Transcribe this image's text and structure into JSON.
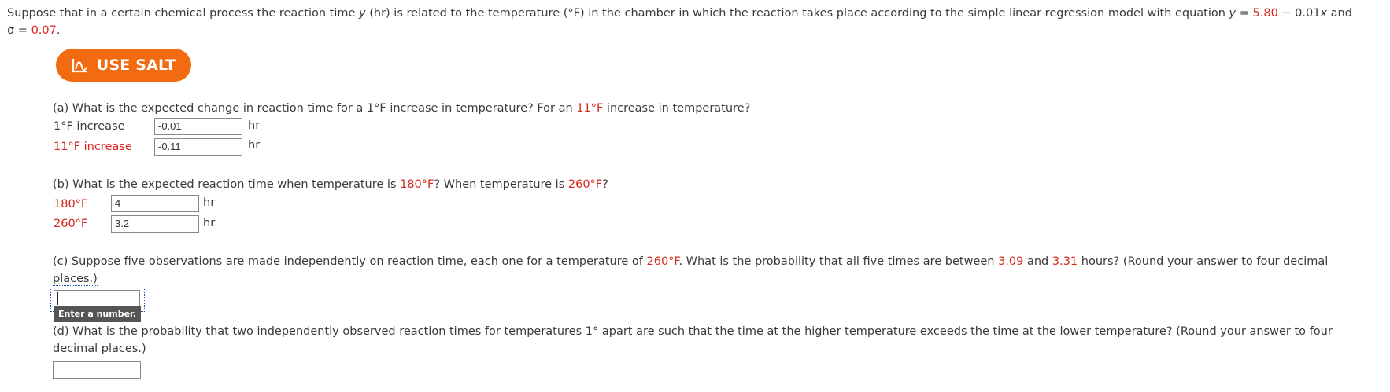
{
  "intro": {
    "line1_a": "Suppose that in a certain chemical process the reaction time ",
    "line1_var_y": "y",
    "line1_b": " (hr) is related to the temperature (°F) in the chamber in which the reaction takes place according to the simple linear regression model with equation ",
    "line1_eq_y": "y",
    "line1_eq": " = ",
    "line1_intercept": "5.80",
    "line1_eq2": " − 0.01",
    "line1_eq_x": "x",
    "line1_end": " and",
    "line2_sigma": "σ",
    "line2_eq": " = ",
    "line2_value": "0.07",
    "line2_end": "."
  },
  "salt_button": {
    "label": "USE SALT",
    "color": "#f26b10"
  },
  "part_a": {
    "q1": "(a) What is the expected change in reaction time for a 1°F increase in temperature? For an ",
    "q_red": "11°F",
    "q2": " increase in temperature?",
    "row1_label": "1°F increase",
    "row1_value": "-0.01",
    "row1_unit": "hr",
    "row2_label": "11°F increase",
    "row2_value": "-0.11",
    "row2_unit": "hr"
  },
  "part_b": {
    "q1": "(b) What is the expected reaction time when temperature is ",
    "q_red1": "180°F",
    "q2": "? When temperature is ",
    "q_red2": "260°F",
    "q3": "?",
    "row1_label": "180°F",
    "row1_value": "4",
    "row1_unit": "hr",
    "row2_label": "260°F",
    "row2_value": "3.2",
    "row2_unit": "hr"
  },
  "part_c": {
    "q1": "(c) Suppose five observations are made independently on reaction time, each one for a temperature of ",
    "q_red1": "260°F",
    "q2": ". What is the probability that all five times are between ",
    "q_red2": "3.09",
    "q3": " and ",
    "q_red3": "3.31",
    "q4": " hours? (Round your answer to four decimal",
    "q5": "places.)",
    "value": "",
    "tooltip": "Enter a number."
  },
  "part_d": {
    "q1": "(d) What is the probability that two independently observed reaction times for temperatures 1° apart are such that the time at the higher temperature exceeds the time at the lower temperature? (Round your answer to four",
    "q2": "decimal places.)",
    "value": ""
  }
}
